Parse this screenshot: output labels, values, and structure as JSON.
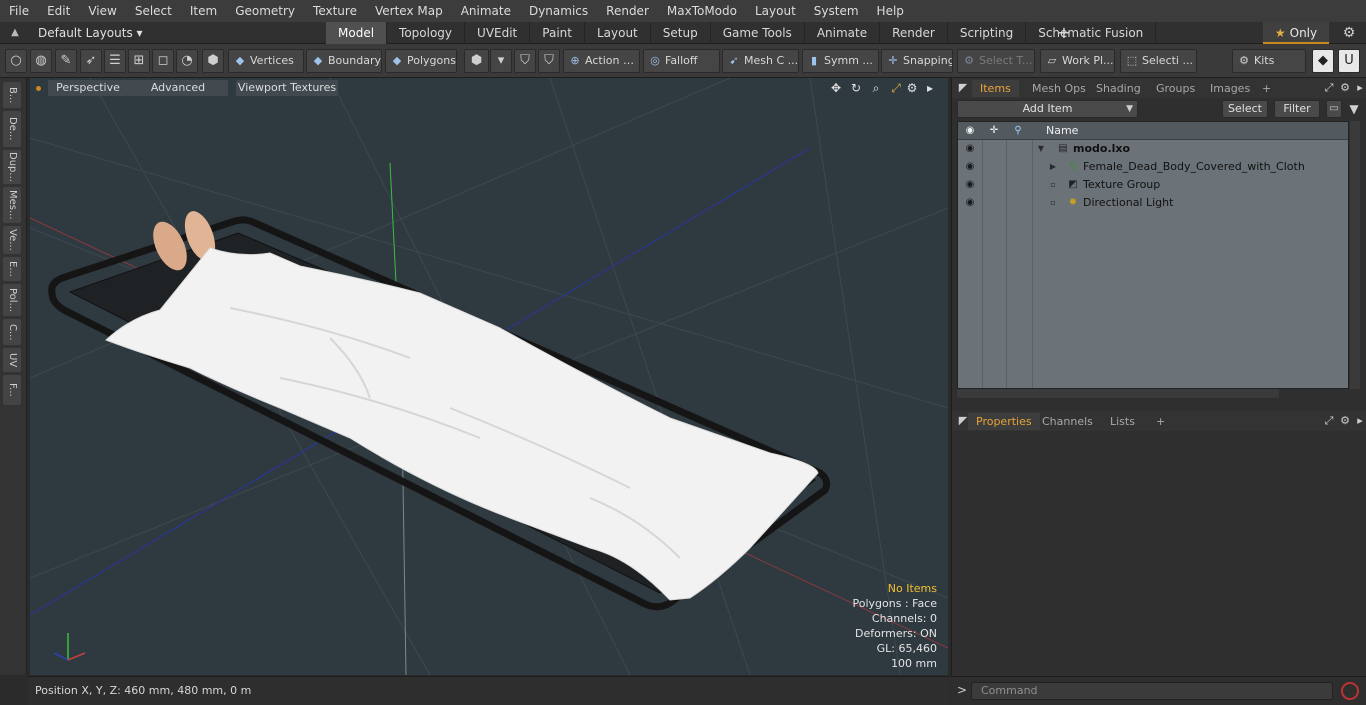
{
  "menu": [
    "File",
    "Edit",
    "View",
    "Select",
    "Item",
    "Geometry",
    "Texture",
    "Vertex Map",
    "Animate",
    "Dynamics",
    "Render",
    "MaxToModo",
    "Layout",
    "System",
    "Help"
  ],
  "layout_selector": "Default Layouts ▾",
  "mode_tabs": [
    "Model",
    "Topology",
    "UVEdit",
    "Paint",
    "Layout",
    "Setup",
    "Game Tools",
    "Animate",
    "Render",
    "Scripting",
    "Schematic Fusion"
  ],
  "active_mode_tab": "Model",
  "only_label": "Only",
  "toolbar": {
    "vertices": "Vertices",
    "boundary": "Boundary",
    "polygons": "Polygons",
    "action": "Action",
    "falloff": "Falloff",
    "mesh": "Mesh C ...",
    "symmetry": "Symm ...",
    "snapping": "Snapping",
    "select_t": "Select T...",
    "work_plane": "Work Pl...",
    "selection": "Selecti ...",
    "kits": "Kits"
  },
  "left_strip": [
    "B...",
    "De...",
    "Dup...",
    "Mes...",
    "Ve...",
    "E...",
    "Pol...",
    "C...",
    "UV",
    "F..."
  ],
  "viewport": {
    "view_mode": "Perspective",
    "shading": "Advanced",
    "textures": "Viewport Textures",
    "info": {
      "selection": "No Items",
      "polygons": "Polygons : Face",
      "channels": "Channels: 0",
      "deformers": "Deformers: ON",
      "gl": "GL: 65,460",
      "scale": "100 mm"
    }
  },
  "status": {
    "position": "Position X, Y, Z:   460 mm, 480 mm, 0 m"
  },
  "items_panel": {
    "tabs": [
      "Items",
      "Mesh Ops",
      "Shading",
      "Groups",
      "Images"
    ],
    "active_tab": "Items",
    "add_item": "Add Item",
    "select": "Select",
    "filter": "Filter",
    "column_name": "Name",
    "tree": [
      {
        "label": "modo.lxo",
        "icon": "scene-icon"
      },
      {
        "label": "Female_Dead_Body_Covered_with_Cloth",
        "icon": "mesh-icon"
      },
      {
        "label": "Texture Group",
        "icon": "texture-group-icon"
      },
      {
        "label": "Directional Light",
        "icon": "light-icon"
      }
    ]
  },
  "properties_panel": {
    "tabs": [
      "Properties",
      "Channels",
      "Lists"
    ],
    "active_tab": "Properties"
  },
  "command": {
    "prompt": ">",
    "placeholder": "Command"
  },
  "colors": {
    "accent": "#e8a438",
    "viewport_bg": "#2e3940",
    "info_highlight": "#f2c030"
  }
}
